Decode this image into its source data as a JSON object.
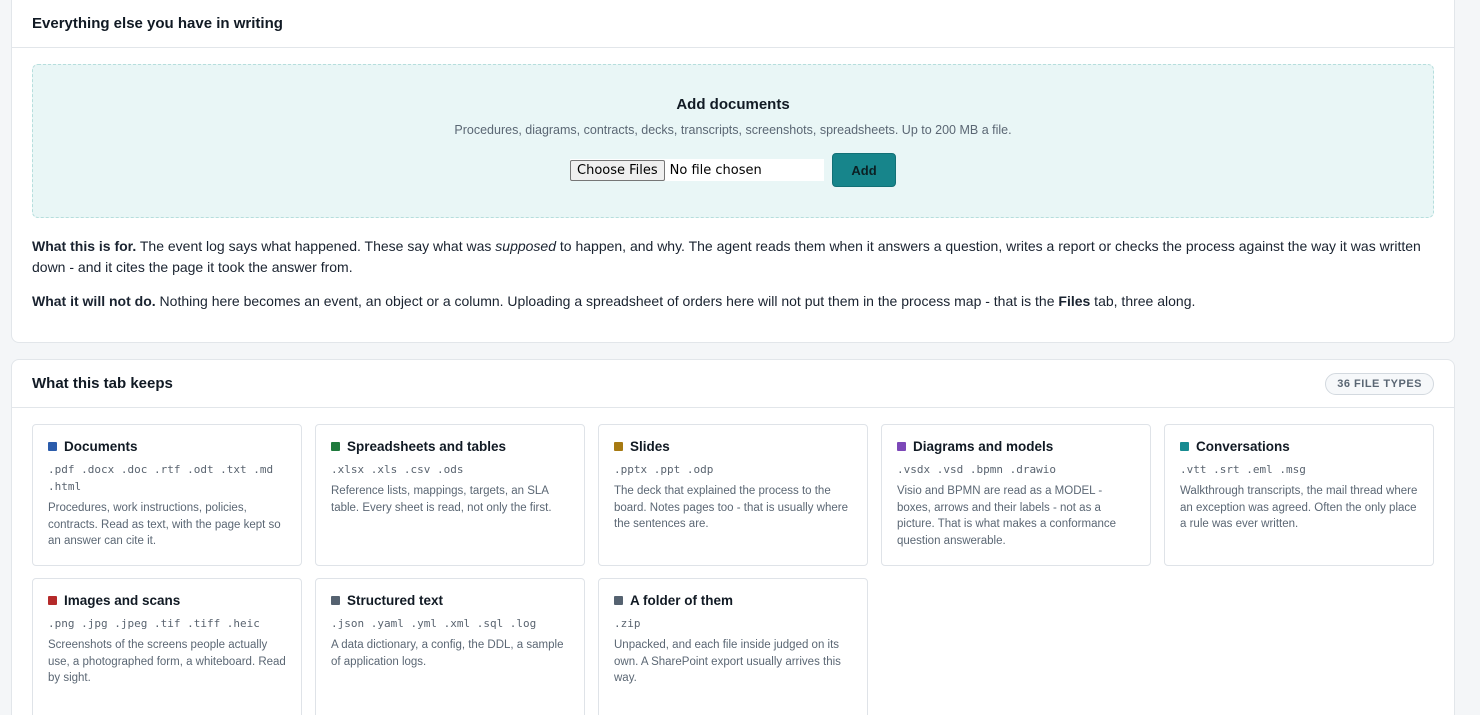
{
  "top_card": {
    "title": "Everything else you have in writing",
    "dropzone": {
      "title": "Add documents",
      "subtitle": "Procedures, diagrams, contracts, decks, transcripts, screenshots, spreadsheets. Up to 200 MB a file.",
      "choose_label": "Choose Files",
      "no_file_label": "No file chosen",
      "add_label": "Add"
    },
    "purpose": {
      "lead": "What this is for.",
      "text_a": " The event log says what happened. These say what was ",
      "emph": "supposed",
      "text_b": " to happen, and why. The agent reads them when it answers a question, writes a report or checks the process against the way it was written down - and it cites the page it took the answer from."
    },
    "limits": {
      "lead": "What it will not do.",
      "text_a": " Nothing here becomes an event, an object or a column. Uploading a spreadsheet of orders here will not put them in the process map - that is the ",
      "strong": "Files",
      "text_b": " tab, three along."
    }
  },
  "bottom_card": {
    "title": "What this tab keeps",
    "badge": "36 FILE TYPES",
    "tiles": [
      {
        "title": "Documents",
        "color": "#2b5cab",
        "icon": "square-dot-icon",
        "ext": ".pdf .docx .doc .rtf .odt .txt .md .html",
        "desc": "Procedures, work instructions, policies, contracts. Read as text, with the page kept so an answer can cite it."
      },
      {
        "title": "Spreadsheets and tables",
        "color": "#1e7a3c",
        "icon": "square-dot-icon",
        "ext": ".xlsx .xls .csv .ods",
        "desc": "Reference lists, mappings, targets, an SLA table. Every sheet is read, not only the first."
      },
      {
        "title": "Slides",
        "color": "#a77a12",
        "icon": "square-dot-icon",
        "ext": ".pptx .ppt .odp",
        "desc": "The deck that explained the process to the board. Notes pages too - that is usually where the sentences are."
      },
      {
        "title": "Diagrams and models",
        "color": "#7c48b8",
        "icon": "square-dot-icon",
        "ext": ".vsdx .vsd .bpmn .drawio",
        "desc": "Visio and BPMN are read as a MODEL - boxes, arrows and their labels - not as a picture. That is what makes a conformance question answerable."
      },
      {
        "title": "Conversations",
        "color": "#178b91",
        "icon": "square-dot-icon",
        "ext": ".vtt .srt .eml .msg",
        "desc": "Walkthrough transcripts, the mail thread where an exception was agreed. Often the only place a rule was ever written."
      },
      {
        "title": "Images and scans",
        "color": "#b52a2a",
        "icon": "square-dot-icon",
        "ext": ".png .jpg .jpeg .tif .tiff .heic",
        "desc": "Screenshots of the screens people actually use, a photographed form, a whiteboard. Read by sight."
      },
      {
        "title": "Structured text",
        "color": "#556270",
        "icon": "square-dot-icon",
        "ext": ".json .yaml .yml .xml .sql .log",
        "desc": "A data dictionary, a config, the DDL, a sample of application logs."
      },
      {
        "title": "A folder of them",
        "color": "#556270",
        "icon": "square-dot-icon",
        "ext": ".zip",
        "desc": "Unpacked, and each file inside judged on its own. A SharePoint export usually arrives this way."
      }
    ]
  }
}
